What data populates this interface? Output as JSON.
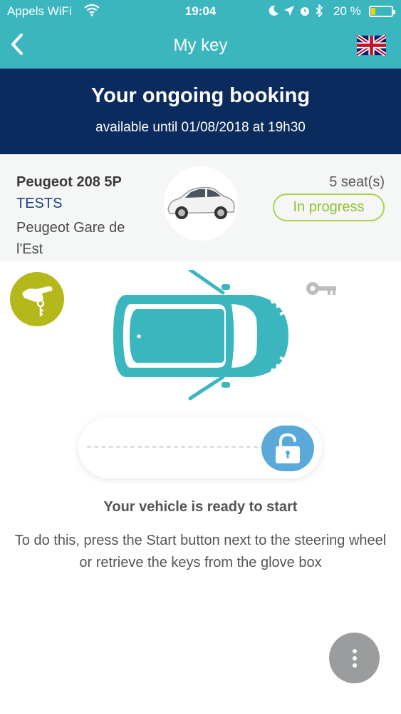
{
  "status_bar": {
    "carrier": "Appels WiFi",
    "time": "19:04",
    "battery_percent": "20 %",
    "battery_level": 0.2,
    "icons": [
      "wifi-icon",
      "moon-icon",
      "location-arrow-icon",
      "alarm-icon",
      "bluetooth-icon",
      "battery-icon"
    ]
  },
  "nav": {
    "title": "My key",
    "back_icon": "chevron-left-icon",
    "language_icon": "uk-flag-icon"
  },
  "booking": {
    "title": "Your ongoing booking",
    "availability": "available until 01/08/2018 at 19h30"
  },
  "vehicle": {
    "model": "Peugeot 208 5P",
    "plate": "TESTS",
    "station": "Peugeot Gare de l'Est",
    "seats": "5 seat(s)",
    "status": "In progress"
  },
  "controls": {
    "hand_icon": "hand-key-icon",
    "key_icon": "key-icon",
    "lock_icon": "padlock-open-icon",
    "menu_icon": "more-vertical-icon"
  },
  "message": {
    "heading": "Your vehicle is ready to start",
    "instructions": "To do this, press the Start button next to the steering wheel or retrieve the keys from the glove box"
  },
  "colors": {
    "teal": "#3bb6bf",
    "navy": "#0b2a5e",
    "green": "#8fc12b",
    "olive": "#b5b81a",
    "lock_blue": "#5aa9d8",
    "grey": "#9a9c9e"
  }
}
